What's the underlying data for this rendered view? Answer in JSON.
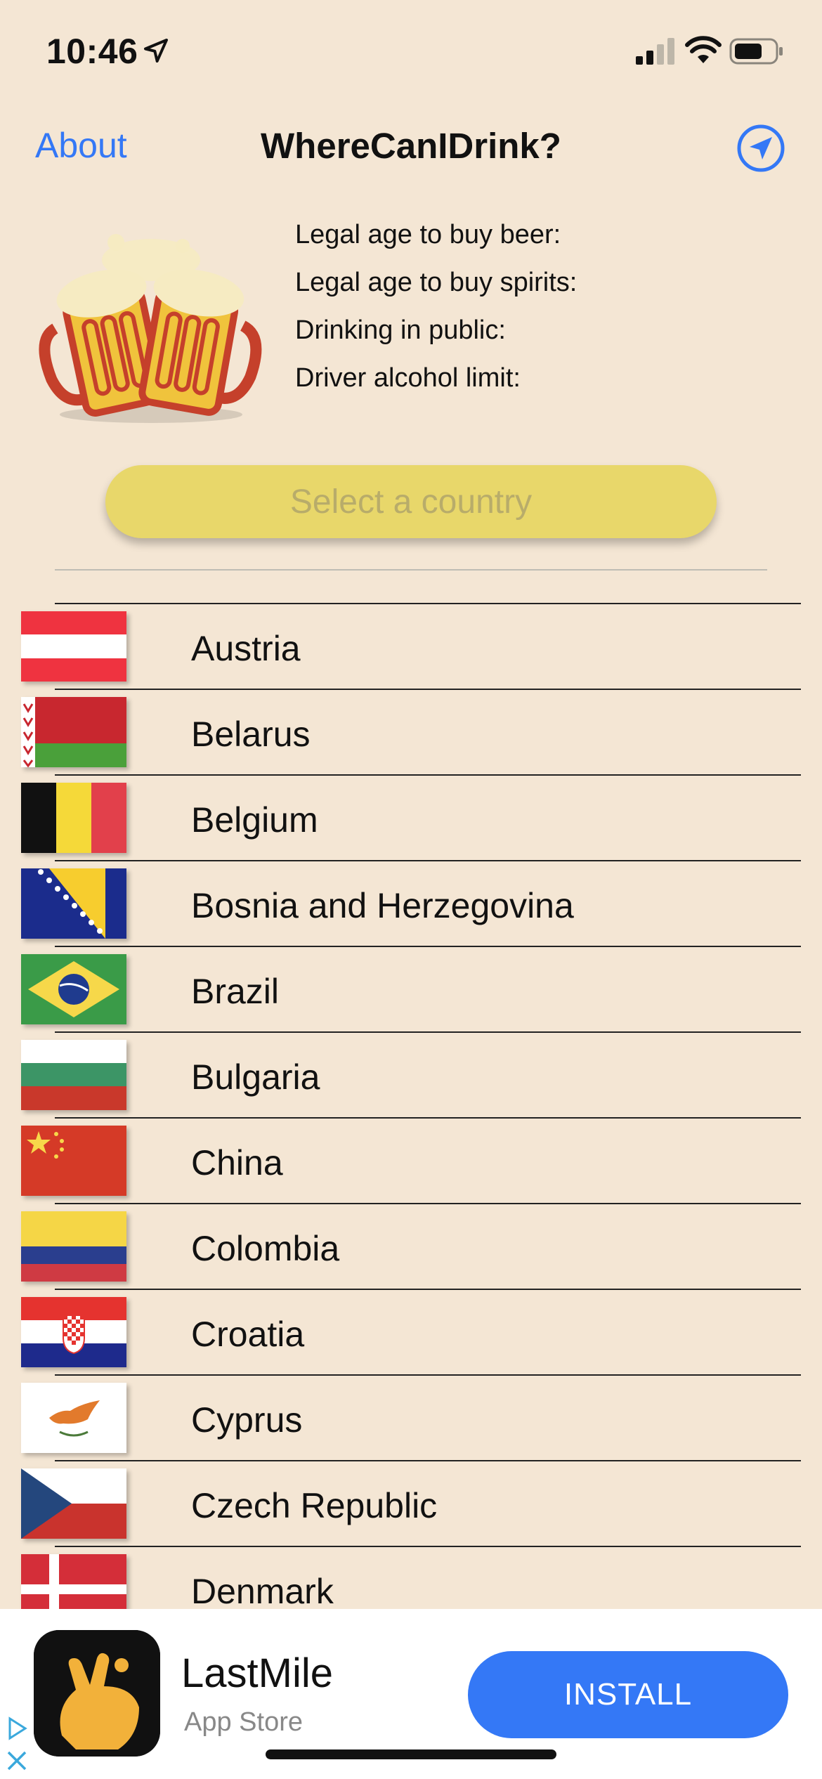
{
  "status": {
    "time": "10:46"
  },
  "nav": {
    "about": "About",
    "title": "WhereCanIDrink?"
  },
  "info": {
    "beer_age": "Legal age to buy beer:",
    "spirits_age": "Legal age to buy spirits:",
    "public": "Drinking in public:",
    "driver_limit": "Driver alcohol limit:"
  },
  "select_button": "Select a country",
  "countries": [
    "Austria",
    "Belarus",
    "Belgium",
    "Bosnia and Herzegovina",
    "Brazil",
    "Bulgaria",
    "China",
    "Colombia",
    "Croatia",
    "Cyprus",
    "Czech Republic",
    "Denmark"
  ],
  "ad": {
    "title": "LastMile",
    "subtitle": "App Store",
    "install": "INSTALL"
  },
  "colors": {
    "accent": "#3478F6",
    "background": "#F4E6D4",
    "select": "#E8D76A"
  }
}
